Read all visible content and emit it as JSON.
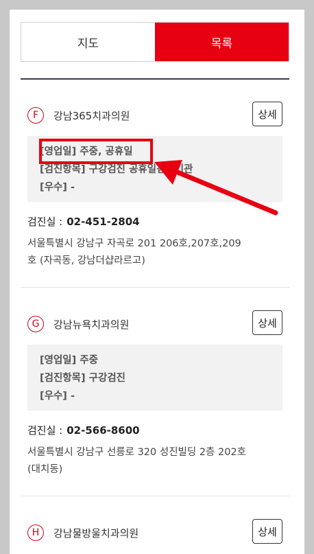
{
  "tabs": {
    "map_label": "지도",
    "list_label": "목록"
  },
  "clinics": [
    {
      "badge": "F",
      "name": "강남365치과의원",
      "detail_label": "상세",
      "hours": "[영업일] 주중, 공휴일",
      "items": "[검진항목] 구강검진 공휴일검진기관",
      "grade": "[우수] -",
      "phone_label": "검진실 :",
      "phone": "02-451-2804",
      "address_line1": "서울특별시 강남구 자곡로 201 206호,207호,209",
      "address_line2": "호 (자곡동, 강남더샵라르고)"
    },
    {
      "badge": "G",
      "name": "강남뉴욕치과의원",
      "detail_label": "상세",
      "hours": "[영업일] 주중",
      "items": "[검진항목] 구강검진",
      "grade": "[우수] -",
      "phone_label": "검진실 :",
      "phone": "02-566-8600",
      "address_line1": "서울특별시 강남구 선릉로 320 성진빌딩 2층 202호",
      "address_line2": "(대치동)"
    },
    {
      "badge": "H",
      "name": "강남물방울치과의원",
      "detail_label": "상세"
    }
  ],
  "annotation": {
    "color": "#e60012"
  }
}
